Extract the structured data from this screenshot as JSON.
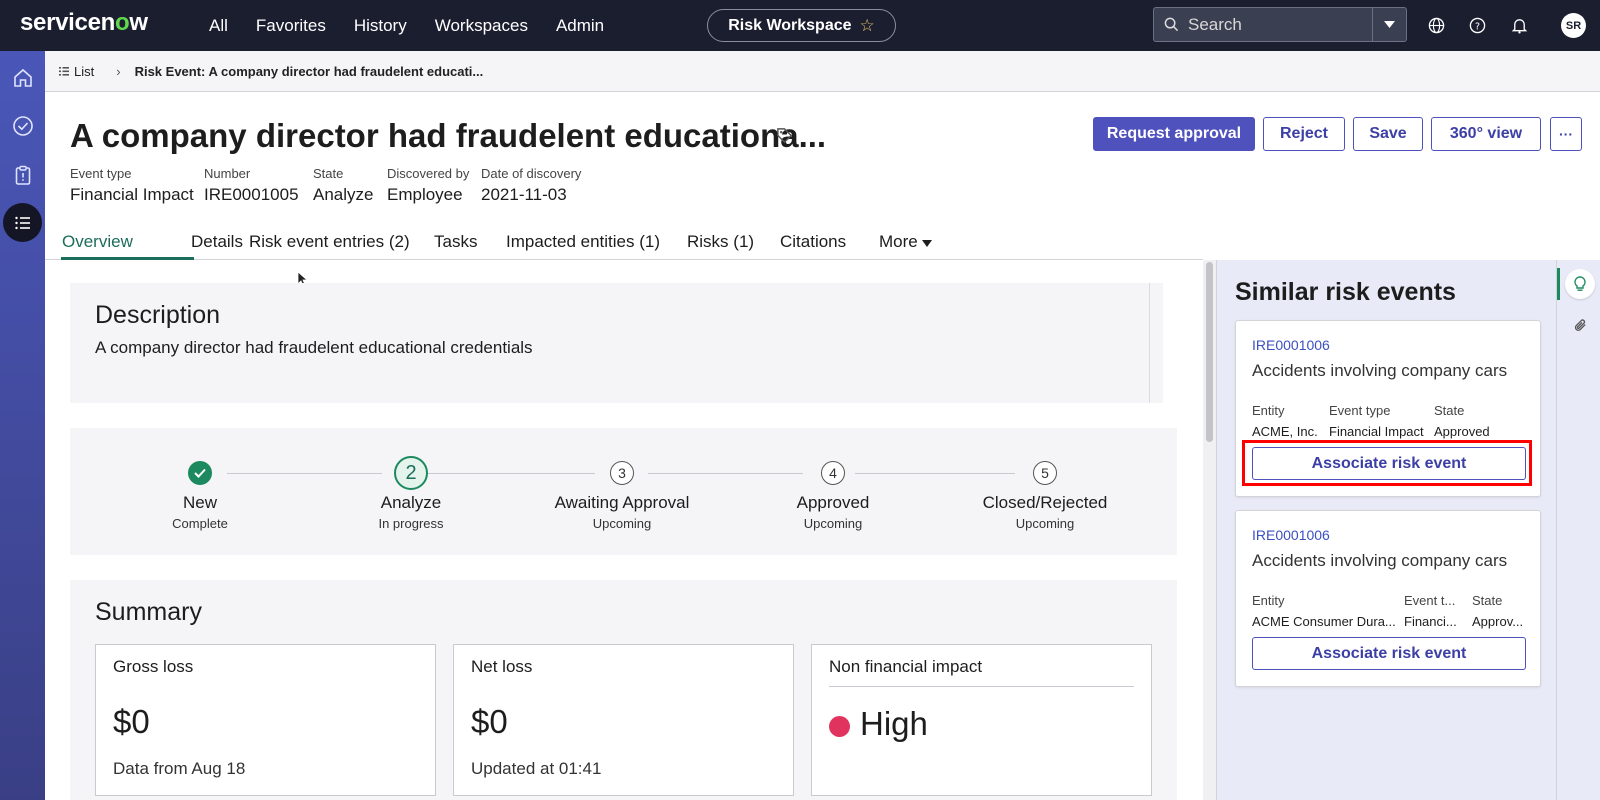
{
  "topnav": {
    "logo": "servicenow",
    "links": [
      "All",
      "Favorites",
      "History",
      "Workspaces",
      "Admin"
    ],
    "workspace_label": "Risk Workspace",
    "search_label": "Search",
    "avatar_initials": "SR"
  },
  "breadcrumb": {
    "list_label": "List",
    "current": "Risk Event: A company director had fraudelent educati..."
  },
  "header": {
    "title": "A company director had fraudelent educationa...",
    "actions": {
      "request_approval": "Request approval",
      "reject": "Reject",
      "save": "Save",
      "view360": "360° view",
      "more": "···"
    },
    "meta": [
      {
        "label": "Event type",
        "value": "Financial Impact"
      },
      {
        "label": "Number",
        "value": "IRE0001005"
      },
      {
        "label": "State",
        "value": "Analyze"
      },
      {
        "label": "Discovered by",
        "value": "Employee"
      },
      {
        "label": "Date of discovery",
        "value": "2021-11-03"
      }
    ]
  },
  "tabs": [
    "Overview",
    "Details",
    "Risk event entries (2)",
    "Tasks",
    "Impacted entities (1)",
    "Risks (1)",
    "Citations",
    "More"
  ],
  "description": {
    "title": "Description",
    "text": "A company director had fraudelent educational credentials"
  },
  "stepper": [
    {
      "num": "1",
      "name": "New",
      "status": "Complete"
    },
    {
      "num": "2",
      "name": "Analyze",
      "status": "In progress"
    },
    {
      "num": "3",
      "name": "Awaiting Approval",
      "status": "Upcoming"
    },
    {
      "num": "4",
      "name": "Approved",
      "status": "Upcoming"
    },
    {
      "num": "5",
      "name": "Closed/Rejected",
      "status": "Upcoming"
    }
  ],
  "summary": {
    "title": "Summary",
    "gross": {
      "title": "Gross loss",
      "value": "$0",
      "note": "Data from Aug 18"
    },
    "net": {
      "title": "Net loss",
      "value": "$0",
      "note": "Updated at 01:41"
    },
    "nonfin": {
      "title": "Non financial impact",
      "value": "High"
    }
  },
  "similar": {
    "title": "Similar risk events",
    "items": [
      {
        "id": "IRE0001006",
        "title": "Accidents involving company cars",
        "cols": [
          {
            "label": "Entity",
            "value": "ACME, Inc."
          },
          {
            "label": "Event type",
            "value": "Financial Impact"
          },
          {
            "label": "State",
            "value": "Approved"
          }
        ],
        "button": "Associate risk event"
      },
      {
        "id": "IRE0001006",
        "title": "Accidents involving company cars",
        "cols": [
          {
            "label": "Entity",
            "value": "ACME Consumer Dura..."
          },
          {
            "label": "Event t...",
            "value": "Financi..."
          },
          {
            "label": "State",
            "value": "Approv..."
          }
        ],
        "button": "Associate risk event"
      }
    ]
  },
  "colors": {
    "nav_bg": "#1b1e2f",
    "accent": "#4f52bd",
    "success": "#1c8a5e",
    "high": "#e0345e"
  }
}
